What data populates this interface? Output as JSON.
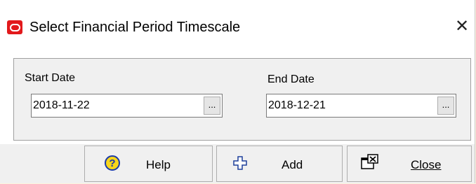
{
  "window": {
    "title": "Select Financial Period Timescale",
    "close_glyph": "✕",
    "icon": "oracle-logo-icon"
  },
  "form": {
    "start_date": {
      "label": "Start Date",
      "value": "2018-11-22",
      "picker_label": "..."
    },
    "end_date": {
      "label": "End Date",
      "value": "2018-12-21",
      "picker_label": "..."
    }
  },
  "buttons": {
    "help": {
      "label": "Help",
      "icon": "help-icon",
      "icon_glyph": "?"
    },
    "add": {
      "label": "Add",
      "icon": "plus-icon"
    },
    "close": {
      "label": "Close",
      "icon": "close-window-icon"
    }
  },
  "colors": {
    "background": "#fdf3dd",
    "panel": "#f0f0f0",
    "brand_red": "#e2191c",
    "help_yellow": "#f7d51b",
    "help_blue": "#1b3aa8"
  }
}
